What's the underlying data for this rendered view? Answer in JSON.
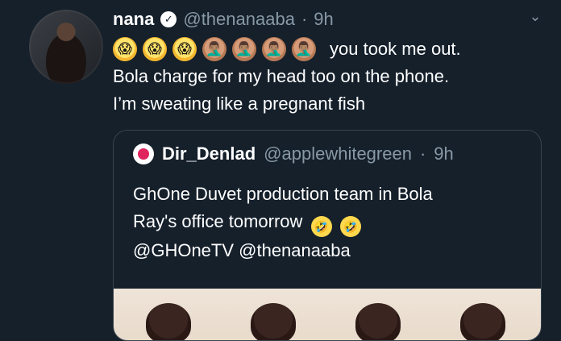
{
  "tweet": {
    "name": "nana",
    "handle": "@thenanaaba",
    "separator": "·",
    "time": "9h",
    "emoji_prefix": [
      "😱",
      "😱",
      "😱",
      "🤦🏽‍♂️",
      "🤦🏽‍♂️",
      "🤦🏽‍♂️",
      "🤦🏽‍♂️"
    ],
    "line1_after_emojis": "you took me out.",
    "line2": "Bola charge for my head too on the phone.",
    "line3": "I’m sweating like a pregnant fish"
  },
  "quote": {
    "name": "Dir_Denlad",
    "handle": "@applewhitegreen",
    "separator": "·",
    "time": "9h",
    "line1": "GhOne Duvet production team in Bola",
    "line2": "Ray's office tomorrow",
    "laugh_emojis": [
      "🤣",
      "🤣"
    ],
    "line3": "@GHOneTV @thenanaaba"
  },
  "colors": {
    "background": "#15202b",
    "secondary_text": "#8899a6",
    "border": "#38444d",
    "verified_badge": "#ffffff"
  },
  "icons": {
    "verified": "verified-badge-icon",
    "more": "chevron-down-icon"
  }
}
